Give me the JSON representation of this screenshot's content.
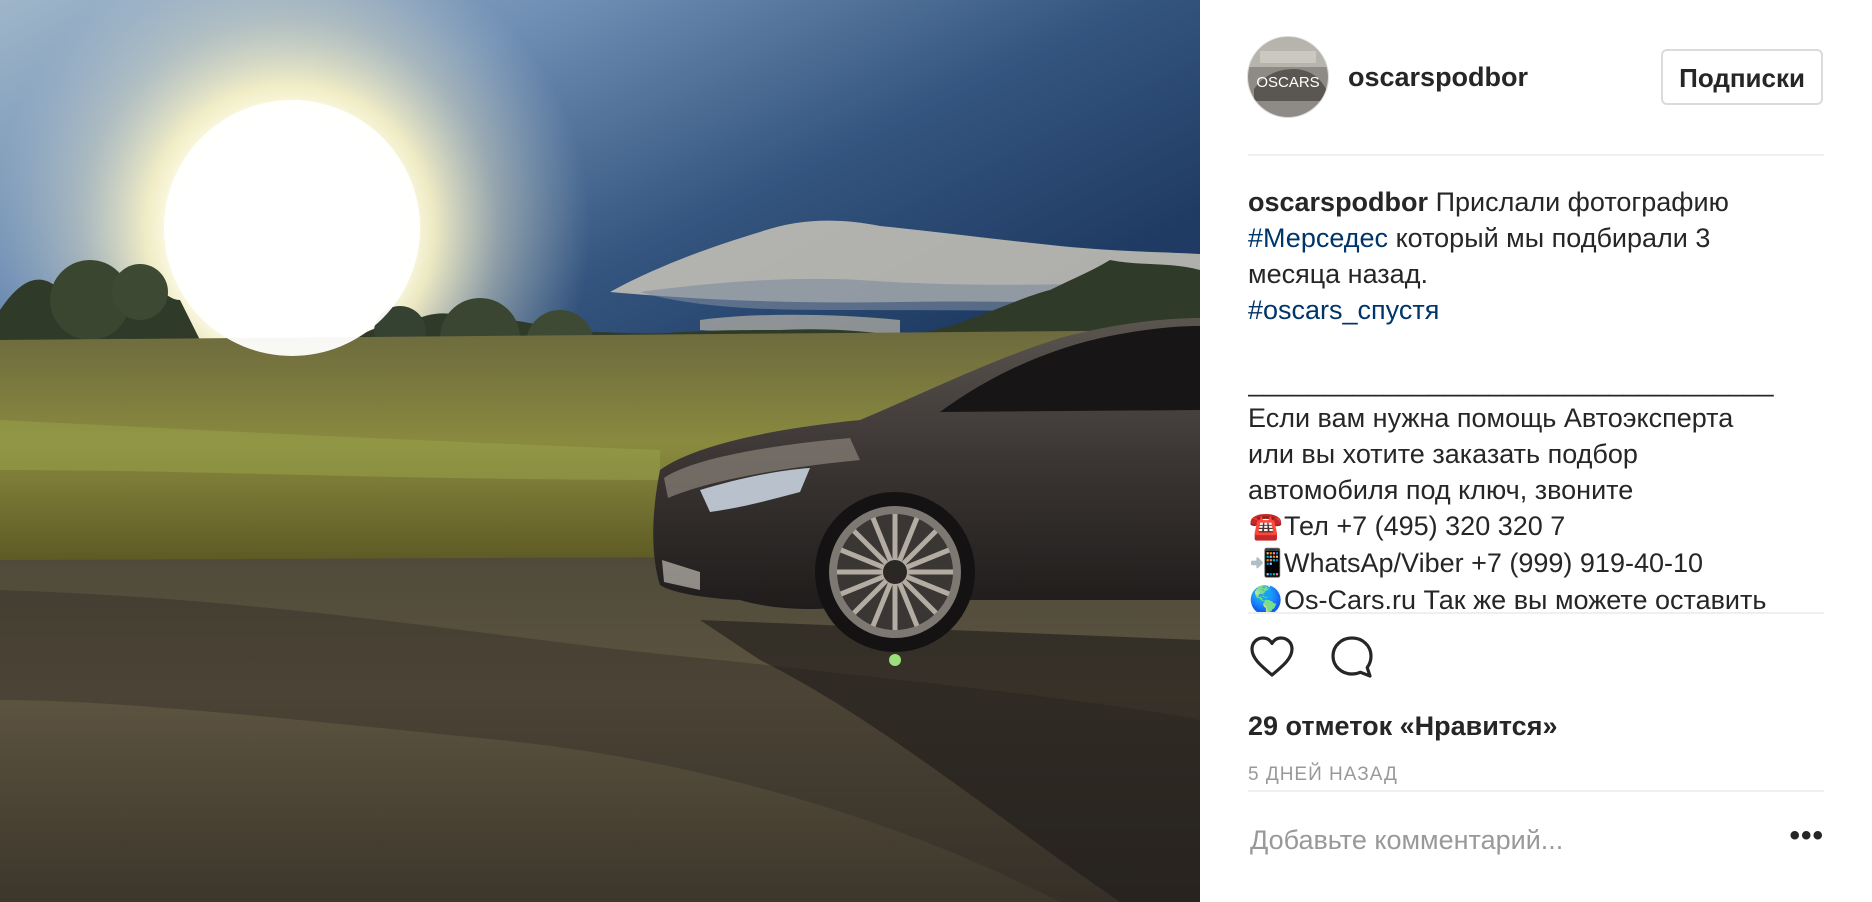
{
  "post": {
    "username": "oscarspodbor",
    "follow_label": "Подписки",
    "avatar_text": "OSCARS",
    "caption": {
      "user": "oscarspodbor",
      "text1": "Прислали фотографию",
      "hashtag1": "#Мерседес",
      "text2": "который мы подбирали 3",
      "text3": "месяца назад.",
      "hashtag2": "#oscars_спустя",
      "separator": "___________________________________",
      "line_a": "Если вам нужна помощь Автоэксперта",
      "line_b": "или вы хотите заказать подбор",
      "line_c": "автомобиля под ключ, звоните",
      "phone_emoji": "☎️",
      "phone_text": "Тел +7 (495) 320 320 7",
      "mobile_emoji": "📲",
      "mobile_text": "WhatsAp/Viber +7 (999) 919-40-10",
      "globe_emoji": "🌎",
      "globe_text": "Os-Cars.ru Так же вы можете оставить"
    },
    "likes": "29 отметок «Нравится»",
    "time": "5 ДНЕЙ НАЗАД",
    "comment_placeholder": "Добавьте комментарий...",
    "more_label": "•••",
    "icons": {
      "like": "heart-icon",
      "comment": "comment-icon",
      "more": "more-options-icon"
    }
  }
}
